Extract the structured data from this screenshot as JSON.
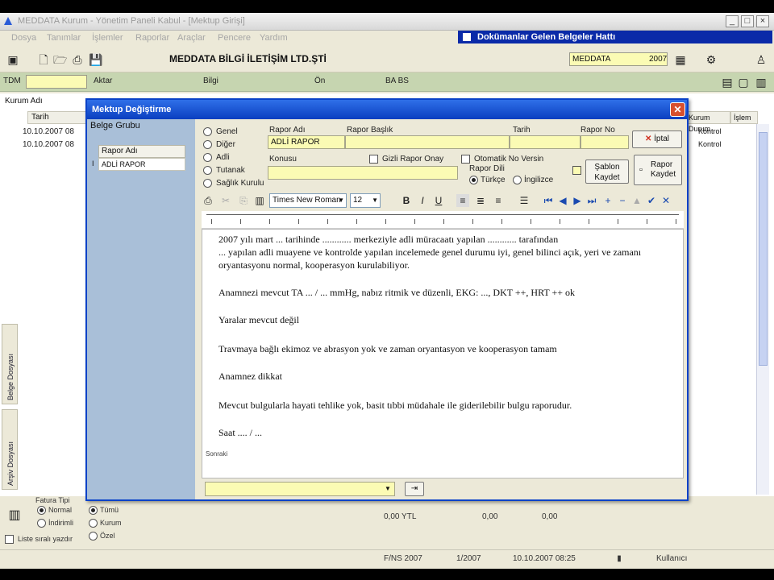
{
  "app": {
    "title": "MEDDATA Kurum - Yönetim Paneli Kabul - [Mektup Girişi]",
    "notification": "Dokümanlar Gelen Belgeler Hattı",
    "menu": [
      "Dosya",
      "Tanımlar",
      "İşlemler",
      "Raporlar",
      "Araçlar",
      "Pencere",
      "Yardım"
    ],
    "company": "MEDDATA BİLGİ İLETİŞİM LTD.ŞTİ",
    "user_field": "MEDDATA",
    "user_year": "2007",
    "toolbar2": {
      "label1": "TDM",
      "btn1": "Aktar",
      "btn2": "Bilgi",
      "btn3": "Ön",
      "btn4": "BA BS"
    }
  },
  "bglist": {
    "header": "Tarih",
    "rows": [
      "10.10.2007 08",
      "10.10.2007 08"
    ],
    "header_label": "Kurum Adı",
    "right_headers": [
      "Kurum Durum",
      "İşlem"
    ],
    "right_rows": [
      "Kontrol",
      "Kontrol"
    ],
    "vtab1": "Belge Dosyası",
    "vtab2": "Arşiv Dosyası"
  },
  "dialog": {
    "title": "Mektup Değiştirme",
    "left_head": "Belge Grubu",
    "left_col": "Rapor Adı",
    "left_item": "ADLİ RAPOR",
    "radios": [
      {
        "label": "Genel",
        "checked": false
      },
      {
        "label": "Diğer",
        "checked": false
      },
      {
        "label": "Adli",
        "checked": false
      },
      {
        "label": "Tutanak",
        "checked": false
      },
      {
        "label": "Sağlık Kurulu",
        "checked": false
      }
    ],
    "fields": {
      "rapor_adi_label": "Rapor Adı",
      "rapor_adi": "ADLİ RAPOR",
      "rapor_baslik_label": "Rapor Başlık",
      "tarih_label": "Tarih",
      "rapor_no_label": "Rapor No",
      "konusu_label": "Konusu",
      "check1": "Gizli Rapor Onay",
      "check2": "Otomatik No Versin",
      "rapor_dili_label": "Rapor Dili",
      "lang1": "Türkçe",
      "lang2": "İngilizce",
      "sablon_check": "Şablon Kaydet",
      "cancel": "İptal",
      "save": "Rapor Kaydet"
    },
    "font_name": "Times New Roman",
    "font_size": "12",
    "paragraphs": [
      "2007 yılı mart ... tarihinde ............ merkeziyle adli müracaatı yapılan ............ tarafından",
      "... yapılan adli muayene ve kontrolde yapılan incelemede genel durumu iyi, genel bilinci açık, yeri ve zamanı",
      "oryantasyonu normal, kooperasyon kurulabiliyor.",
      "Anamnezi mevcut TA ... / ... mmHg, nabız ritmik ve düzenli, EKG: ..., DKT ++, HRT ++ ok",
      "Yaralar mevcut değil",
      "Travmaya bağlı ekimoz ve abrasyon yok ve zaman oryantasyon ve kooperasyon tamam",
      "Anamnez dikkat",
      "Mevcut bulgularla hayati tehlike yok, basit tıbbi müdahale ile giderilebilir bulgu raporudur.",
      "Saat .... / ..."
    ],
    "footer_small": "Sonraki"
  },
  "bottom": {
    "group_title": "Fatura Tipi",
    "radios_left": [
      {
        "label": "Normal",
        "checked": true
      },
      {
        "label": "İndirimli",
        "checked": false
      }
    ],
    "radios_right": [
      {
        "label": "Tümü",
        "checked": true
      },
      {
        "label": "Kurum",
        "checked": false
      },
      {
        "label": "Özel",
        "checked": false
      }
    ],
    "check": "Liste sıralı yazdır",
    "total": "0,00 YTL",
    "total2": "0,00",
    "total3": "0,00"
  },
  "status": {
    "s1": "F/NS 2007",
    "s2": "1/2007",
    "s3": "10.10.2007 08:25",
    "s4": "Kullanıcı"
  }
}
